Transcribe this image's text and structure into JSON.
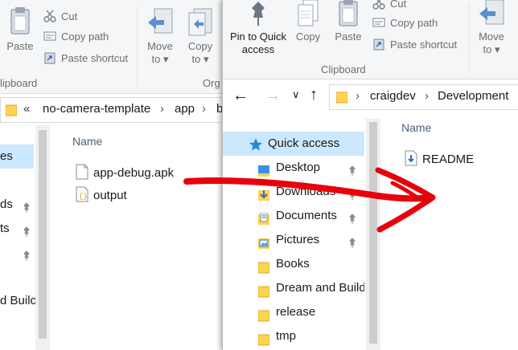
{
  "back_window": {
    "ribbon": {
      "paste": "Paste",
      "cut": "Cut",
      "copy_path": "Copy path",
      "paste_shortcut": "Paste shortcut",
      "move_to_line1": "Move",
      "move_to_line2": "to ▾",
      "copy_to_line1": "Copy",
      "copy_to_line2": "to ▾",
      "clipboard_group": "lipboard",
      "organize_group": "Org"
    },
    "address": {
      "chevron": "«",
      "crumbs": [
        "no-camera-template",
        "app",
        "b"
      ]
    },
    "nav_items": [
      "es",
      "ds",
      "ts",
      "",
      "d Builc"
    ],
    "column_name": "Name",
    "files": [
      {
        "name": "app-debug.apk",
        "icon": "file-icon"
      },
      {
        "name": "output",
        "icon": "json-file-icon"
      }
    ]
  },
  "front_window": {
    "ribbon": {
      "pin_line1": "Pin to Quick",
      "pin_line2": "access",
      "copy": "Copy",
      "paste": "Paste",
      "cut": "Cut",
      "copy_path": "Copy path",
      "paste_shortcut": "Paste shortcut",
      "move_to_line1": "Move",
      "move_to_line2": "to ▾",
      "clipboard_group": "Clipboard"
    },
    "address": {
      "crumbs": [
        "craigdev",
        "Development"
      ]
    },
    "nav": {
      "quick_access": "Quick access",
      "items": [
        {
          "label": "Desktop",
          "pinned": true
        },
        {
          "label": "Downloads",
          "pinned": true
        },
        {
          "label": "Documents",
          "pinned": true
        },
        {
          "label": "Pictures",
          "pinned": true
        },
        {
          "label": "Books",
          "pinned": false
        },
        {
          "label": "Dream and Build",
          "pinned": false
        },
        {
          "label": "release",
          "pinned": false
        },
        {
          "label": "tmp",
          "pinned": false
        }
      ]
    },
    "column_name": "Name",
    "files": [
      {
        "name": "README",
        "icon": "readme-file-icon"
      }
    ]
  },
  "annotation": {
    "color": "#e8000b",
    "description_icon": "red-drag-arrow"
  }
}
